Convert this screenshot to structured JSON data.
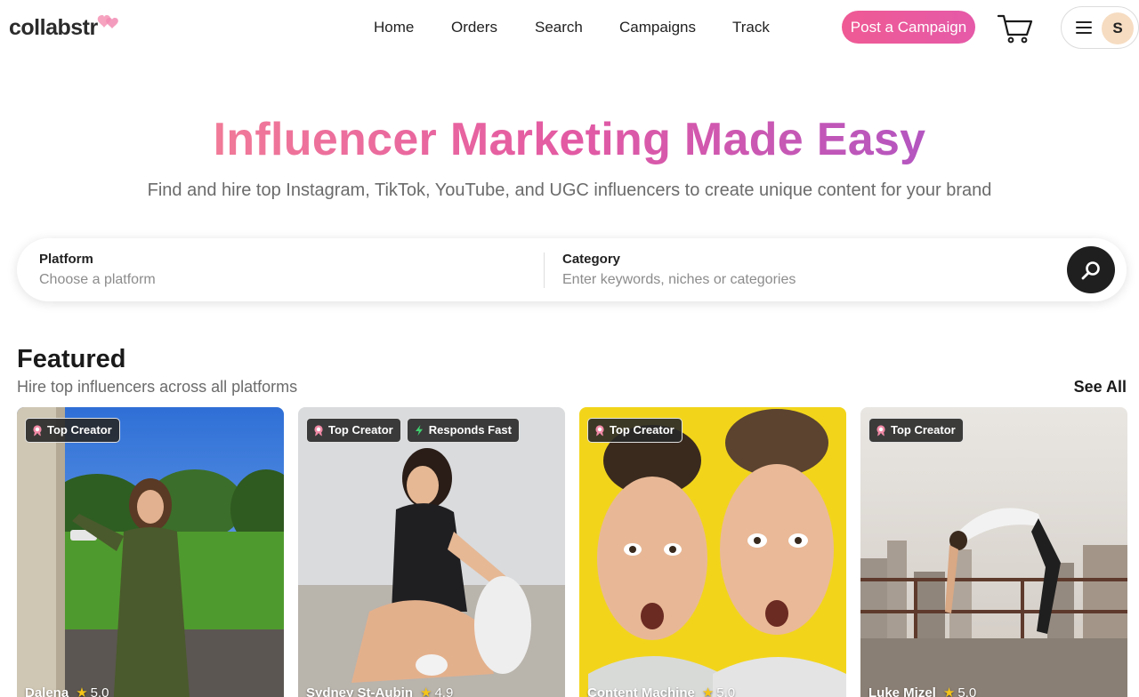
{
  "header": {
    "logo_text": "collabstr",
    "nav": [
      "Home",
      "Orders",
      "Search",
      "Campaigns",
      "Track"
    ],
    "post_button": "Post a Campaign",
    "avatar_initial": "S"
  },
  "hero": {
    "title": "Influencer Marketing Made Easy",
    "subtitle": "Find and hire top Instagram, TikTok, YouTube, and UGC influencers to create unique content for your brand"
  },
  "search": {
    "platform_label": "Platform",
    "platform_placeholder": "Choose a platform",
    "category_label": "Category",
    "category_placeholder": "Enter keywords, niches or categories"
  },
  "featured": {
    "title": "Featured",
    "subtitle": "Hire top influencers across all platforms",
    "see_all": "See All",
    "cards": [
      {
        "name": "Dalena",
        "rating": "5.0",
        "badges": [
          "Top Creator"
        ]
      },
      {
        "name": "Sydney St-Aubin",
        "rating": "4.9",
        "badges": [
          "Top Creator",
          "Responds Fast"
        ]
      },
      {
        "name": "Content Machine",
        "rating": "5.0",
        "badges": [
          "Top Creator"
        ]
      },
      {
        "name": "Luke Mizel",
        "rating": "5.0",
        "badges": [
          "Top Creator"
        ]
      }
    ]
  },
  "colors": {
    "brand_pink": "#ef5a94",
    "title_gradient_start": "#f17a98",
    "title_gradient_end": "#b456c0",
    "search_button": "#1f1f1f",
    "star": "#f5c518"
  },
  "icons": [
    "logo-heart-icon",
    "cart-icon",
    "menu-icon",
    "search-icon",
    "rosette-icon",
    "lightning-icon",
    "star-icon"
  ]
}
